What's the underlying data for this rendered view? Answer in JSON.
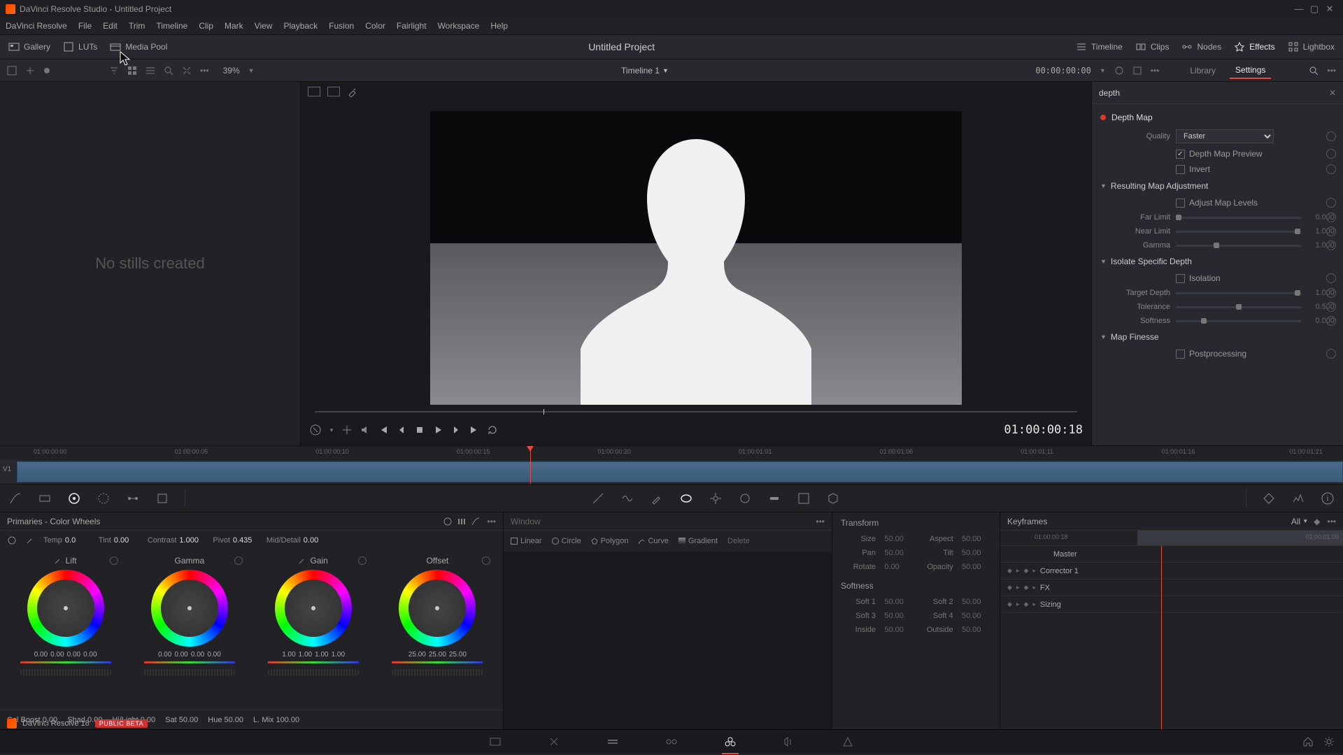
{
  "titlebar": {
    "text": "DaVinci Resolve Studio - Untitled Project"
  },
  "menu": [
    "DaVinci Resolve",
    "File",
    "Edit",
    "Trim",
    "Timeline",
    "Clip",
    "Mark",
    "View",
    "Playback",
    "Fusion",
    "Color",
    "Fairlight",
    "Workspace",
    "Help"
  ],
  "toolbar": {
    "gallery": "Gallery",
    "luts": "LUTs",
    "mediapool": "Media Pool",
    "project": "Untitled Project",
    "timeline": "Timeline",
    "clips": "Clips",
    "nodes": "Nodes",
    "effects": "Effects",
    "lightbox": "Lightbox"
  },
  "subbar": {
    "zoom": "39%",
    "timeline_name": "Timeline 1",
    "timecode": "00:00:00:00",
    "tabs": {
      "library": "Library",
      "settings": "Settings"
    }
  },
  "gallery": {
    "empty": "No stills created"
  },
  "viewer": {
    "timecode": "01:00:00:18"
  },
  "inspector": {
    "search": "depth",
    "title": "Depth Map",
    "quality_label": "Quality",
    "quality_value": "Faster",
    "preview_label": "Depth Map Preview",
    "preview_checked": true,
    "invert_label": "Invert",
    "groups": {
      "resulting": "Resulting Map Adjustment",
      "adjust_levels": "Adjust Map Levels",
      "far_limit": "Far Limit",
      "far_limit_v": "0.000",
      "near_limit": "Near Limit",
      "near_limit_v": "1.000",
      "gamma": "Gamma",
      "gamma_v": "1.000",
      "isolate": "Isolate Specific Depth",
      "isolation": "Isolation",
      "target_depth": "Target Depth",
      "target_depth_v": "1.000",
      "tolerance": "Tolerance",
      "tolerance_v": "0.500",
      "softness": "Softness",
      "softness_v": "0.000",
      "finesse": "Map Finesse",
      "postprocessing": "Postprocessing"
    }
  },
  "timeline": {
    "track": "V1",
    "marks": [
      "01:00:00:00",
      "01:00:00:05",
      "01:00:00:10",
      "01:00:00:15",
      "01:00:00:20",
      "01:00:01:01",
      "01:00:01:06",
      "01:00:01:11",
      "01:00:01:16",
      "01:00:01:21"
    ]
  },
  "wheels": {
    "title": "Primaries - Color Wheels",
    "adjust": {
      "temp": "Temp",
      "temp_v": "0.0",
      "tint": "Tint",
      "tint_v": "0.00",
      "contrast": "Contrast",
      "contrast_v": "1.000",
      "pivot": "Pivot",
      "pivot_v": "0.435",
      "md": "Mid/Detail",
      "md_v": "0.00"
    },
    "names": [
      "Lift",
      "Gamma",
      "Gain",
      "Offset"
    ],
    "nums": {
      "lift": [
        "0.00",
        "0.00",
        "0.00",
        "0.00"
      ],
      "gamma": [
        "0.00",
        "0.00",
        "0.00",
        "0.00"
      ],
      "gain": [
        "1.00",
        "1.00",
        "1.00",
        "1.00"
      ],
      "offset": [
        "25.00",
        "25.00",
        "25.00"
      ]
    },
    "bottom": {
      "colboost": "Col Boost",
      "colboost_v": "0.00",
      "shad": "Shad",
      "shad_v": "0.00",
      "hilight": "Hi/Light",
      "hilight_v": "0.00",
      "sat": "Sat",
      "sat_v": "50.00",
      "hue": "Hue",
      "hue_v": "50.00",
      "lmix": "L. Mix",
      "lmix_v": "100.00"
    }
  },
  "curves": {
    "title": "Window",
    "tools": [
      "Linear",
      "Circle",
      "Polygon",
      "Curve",
      "Gradient",
      "Delete"
    ]
  },
  "transform": {
    "head1": "Transform",
    "size": "Size",
    "size_v": "50.00",
    "aspect": "Aspect",
    "aspect_v": "50.00",
    "pan": "Pan",
    "pan_v": "50.00",
    "tilt": "Tilt",
    "tilt_v": "50.00",
    "rotate": "Rotate",
    "rotate_v": "0.00",
    "opacity": "Opacity",
    "opacity_v": "50.00",
    "head2": "Softness",
    "s1": "Soft 1",
    "s1_v": "50.00",
    "s2": "Soft 2",
    "s2_v": "50.00",
    "s3": "Soft 3",
    "s3_v": "50.00",
    "s4": "Soft 4",
    "s4_v": "50.00",
    "inside": "Inside",
    "inside_v": "50.00",
    "outside": "Outside",
    "outside_v": "50.00"
  },
  "keyframes": {
    "title": "Keyframes",
    "all": "All",
    "ruler": [
      "01:00:00:18",
      "01:00:01:09"
    ],
    "rows": [
      "Master",
      "Corrector 1",
      "FX",
      "Sizing"
    ]
  },
  "status": {
    "app": "DaVinci Resolve 18",
    "beta": "PUBLIC BETA"
  }
}
